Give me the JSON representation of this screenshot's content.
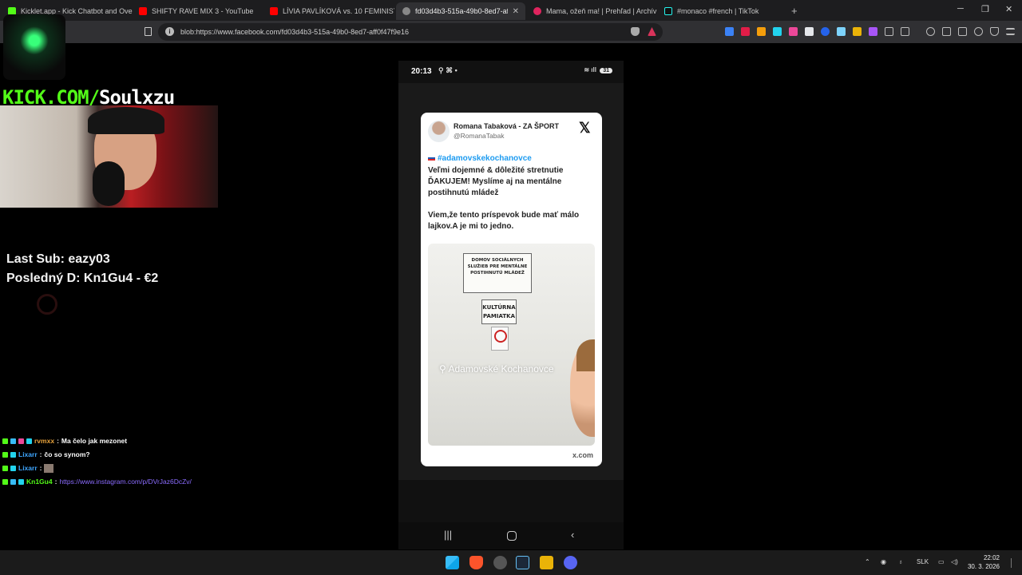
{
  "browser": {
    "tabs": [
      {
        "title": "Kicklet.app - Kick Chatbot and Overla",
        "icon": "kicklet-icon",
        "active": false
      },
      {
        "title": "SHIFTY RAVE MIX 3 - YouTube",
        "icon": "youtube-icon",
        "active": false
      },
      {
        "title": "LÍVIA PAVLÍKOVÁ vs. 10 FEMINISTOV",
        "icon": "youtube-icon",
        "active": false
      },
      {
        "title": "fd03d4b3-515a-49b0-8ed7-aff0f",
        "icon": "globe-icon",
        "active": true
      },
      {
        "title": "Mama, ožeň ma! | Prehľad | Archív | T",
        "icon": "tv-icon",
        "active": false
      },
      {
        "title": "#monaco #french | TikTok",
        "icon": "tiktok-icon",
        "active": false
      }
    ],
    "new_tab": "+",
    "url": "blob:https://www.facebook.com/fd03d4b3-515a-49b0-8ed7-aff0f47f9e16"
  },
  "overlay": {
    "kick_prefix": "KICK.COM/",
    "kick_channel": "Soulxzu",
    "last_sub": "Last Sub: eazy03",
    "last_donation": "Posledný D: Kn1Gu4 - €2"
  },
  "chat": [
    {
      "user": "rvmxx",
      "user_color": "#e8a33c",
      "message": "Ma čelo jak mezonet"
    },
    {
      "user": "Lixarr",
      "user_color": "#3ea6ff",
      "message": "čo so synom?"
    },
    {
      "user": "Lixarr",
      "user_color": "#3ea6ff",
      "message": ""
    },
    {
      "user": "Kn1Gu4",
      "user_color": "#53fc18",
      "message": "https://www.instagram.com/p/DVrJaz6DcZv/"
    }
  ],
  "phone": {
    "time": "20:13",
    "battery": "31"
  },
  "post": {
    "author_name": "Romana Tabaková - ZA ŠPORT",
    "author_handle": "@RomanaTabak",
    "hashtag": "#adamovskekochanovce",
    "paragraph1": "Veľmi dojemné & dôležité stretnutie ĎAKUJEM! Myslíme aj na mentálne postihnutú mládež",
    "paragraph2": "Viem,že tento príspevok bude mať málo lajkov.A je mi to jedno.",
    "sign1": "DOMOV SOCIÁLNYCH SLUŽIEB PRE MENTÁLNE POSTIHNUTÚ MLÁDEŽ",
    "sign2": "KULTÚRNA PAMIATKA",
    "location": "Adamovské Kochanovce",
    "source": "x.com"
  },
  "taskbar": {
    "language": "SLK",
    "time": "22:02",
    "date": "30. 3. 2026"
  },
  "colors": {
    "kick_green": "#53fc18",
    "x_blue": "#1d9bf0",
    "chat_link": "#8b6cff"
  }
}
